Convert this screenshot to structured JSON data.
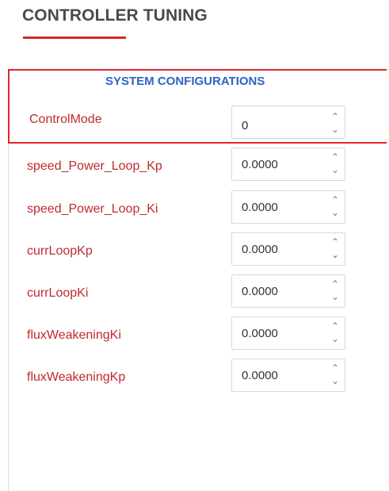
{
  "page": {
    "title": "CONTROLLER TUNING",
    "accent_color": "#d7262b",
    "heading_color": "#2c63c5",
    "label_color": "#c0292e"
  },
  "system_config": {
    "heading": "SYSTEM CONFIGURATIONS",
    "control_mode": {
      "label": "ControlMode",
      "value": "0"
    }
  },
  "params": [
    {
      "label": "speed_Power_Loop_Kp",
      "value": "0.0000"
    },
    {
      "label": "speed_Power_Loop_Ki",
      "value": "0.0000"
    },
    {
      "label": "currLoopKp",
      "value": "0.0000"
    },
    {
      "label": "currLoopKi",
      "value": "0.0000"
    },
    {
      "label": "fluxWeakeningKi",
      "value": "0.0000"
    },
    {
      "label": "fluxWeakeningKp",
      "value": "0.0000"
    }
  ],
  "stepper": {
    "up_glyph": "⌃",
    "down_glyph": "⌄",
    "up_icon": "chevron-up-icon",
    "down_icon": "chevron-down-icon"
  }
}
